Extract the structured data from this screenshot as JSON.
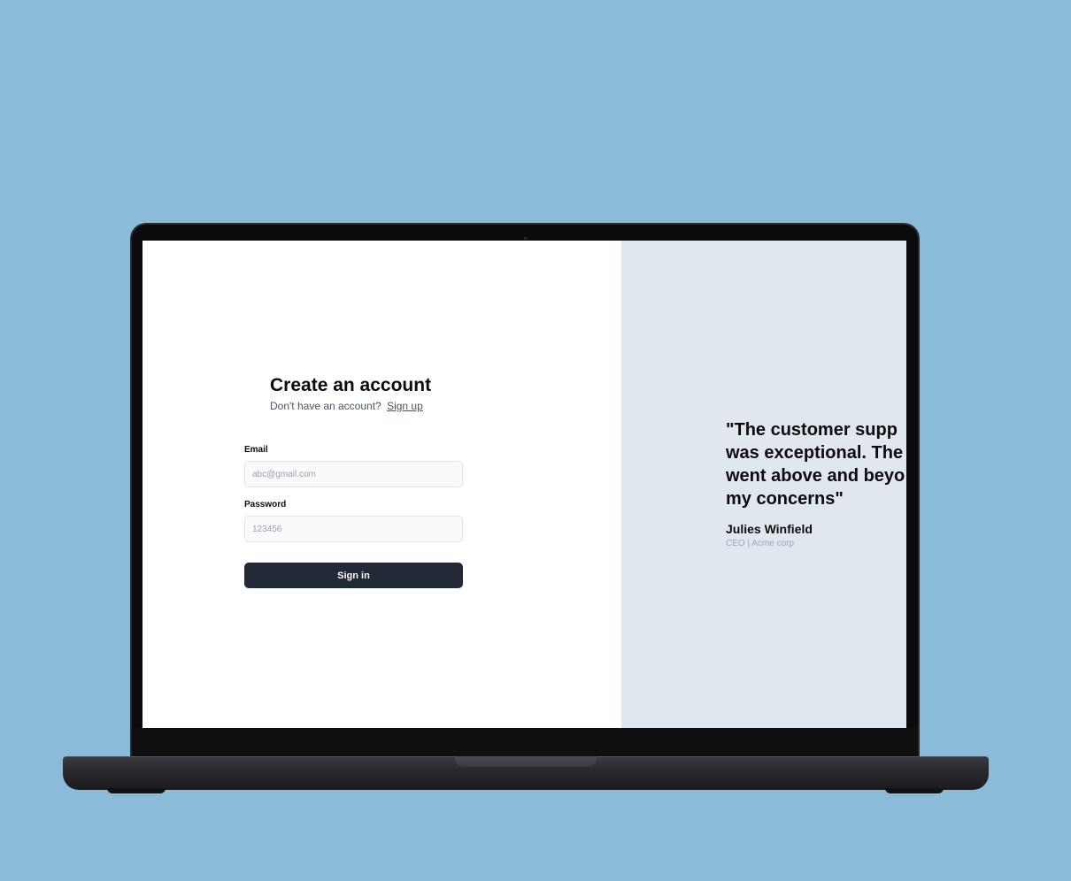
{
  "signup": {
    "title": "Create an account",
    "subtitle_text": "Don't have an account?",
    "subtitle_link": "Sign up",
    "email_label": "Email",
    "email_placeholder": "abc@gmail.com",
    "password_label": "Password",
    "password_placeholder": "123456",
    "submit_label": "Sign in"
  },
  "testimonial": {
    "quote_lines": [
      "\"The customer supp",
      "was exceptional. The",
      "went above and beyo",
      "my concerns\""
    ],
    "author": "Julies Winfield",
    "role": "CEO | Acme corp"
  },
  "colors": {
    "background": "#8abcd9",
    "testimonial_panel": "#e1e7ef",
    "button": "#222a38"
  }
}
